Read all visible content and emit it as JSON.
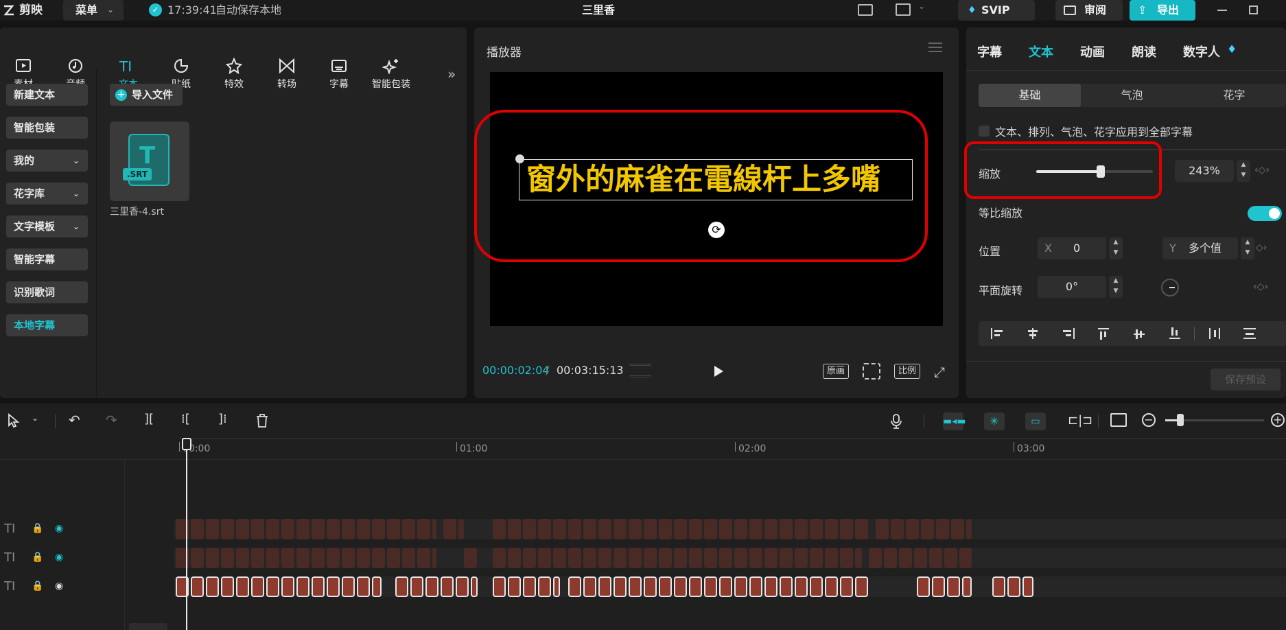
{
  "app": {
    "logo": "剪映",
    "menu_label": "菜单",
    "autosave_time": "17:39:41",
    "autosave_text": "自动保存本地",
    "project_title": "三里香",
    "svip_label": "SVIP",
    "review_label": "审阅",
    "export_label": "导出"
  },
  "toolbar": {
    "items": [
      {
        "label": "素材"
      },
      {
        "label": "音频"
      },
      {
        "label": "文本"
      },
      {
        "label": "贴纸"
      },
      {
        "label": "特效"
      },
      {
        "label": "转场"
      },
      {
        "label": "字幕"
      },
      {
        "label": "智能包装"
      }
    ],
    "more": "»"
  },
  "sidebar": {
    "items": [
      {
        "label": "新建文本"
      },
      {
        "label": "智能包装"
      },
      {
        "label": "我的"
      },
      {
        "label": "花字库"
      },
      {
        "label": "文字模板"
      },
      {
        "label": "智能字幕"
      },
      {
        "label": "识别歌词"
      },
      {
        "label": "本地字幕"
      }
    ]
  },
  "library": {
    "import_label": "导入文件",
    "file_badge": ".SRT",
    "file_glyph": "T",
    "file_name": "三里香-4.srt"
  },
  "player": {
    "title": "播放器",
    "subtitle_text": "窗外的麻雀在電線杆上多嘴",
    "current_time": "00:00:02:04",
    "separator": "/",
    "total_time": "00:03:15:13",
    "btn_original": "原画",
    "btn_ratio": "比例"
  },
  "inspector": {
    "tabs": [
      {
        "label": "字幕"
      },
      {
        "label": "文本"
      },
      {
        "label": "动画"
      },
      {
        "label": "朗读"
      },
      {
        "label": "数字人"
      }
    ],
    "segments": [
      {
        "label": "基础"
      },
      {
        "label": "气泡"
      },
      {
        "label": "花字"
      }
    ],
    "apply_all_label": "文本、排列、气泡、花字应用到全部字幕",
    "scale_label": "缩放",
    "scale_value": "243%",
    "scale_fraction": 0.55,
    "uniform_label": "等比缩放",
    "position_label": "位置",
    "pos_x_label": "X",
    "pos_x_value": "0",
    "pos_y_label": "Y",
    "pos_y_value": "多个值",
    "rotation_label": "平面旋转",
    "rotation_value": "0°",
    "save_preset_label": "保存预设"
  },
  "timeline": {
    "ticks": [
      {
        "label": "00:00"
      },
      {
        "label": "01:00"
      },
      {
        "label": "02:00"
      },
      {
        "label": "03:00"
      }
    ],
    "track_icon": "TI",
    "zoom_fraction": 0.15
  },
  "colors": {
    "accent": "#20c4cf",
    "highlight": "#e00000",
    "subtitle": "#f2c700",
    "clip": "#8e3b2e"
  }
}
